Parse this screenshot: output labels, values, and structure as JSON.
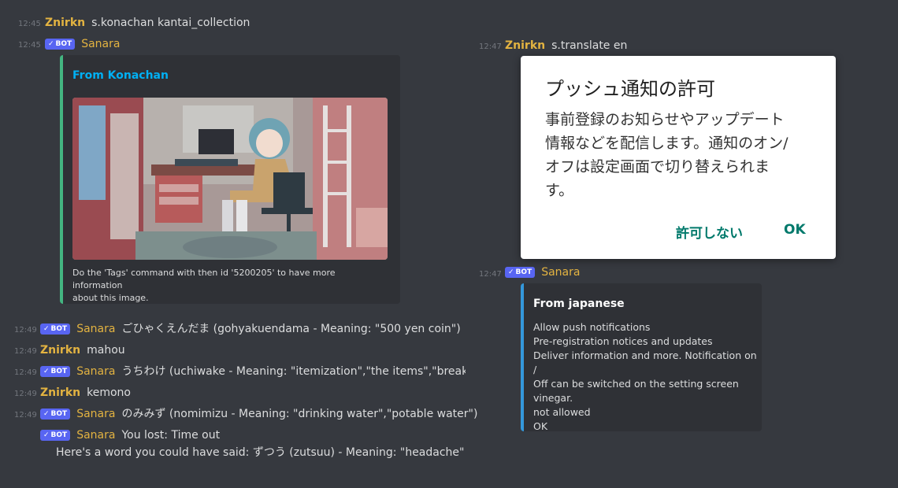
{
  "messages_left": [
    {
      "time": "12:45",
      "author": "Znirkn",
      "text": "s.konachan kantai_collection"
    },
    {
      "time": "12:45",
      "author": "Sanara",
      "bot": "BOT"
    }
  ],
  "konachan_embed": {
    "title": "From Konachan",
    "accent": "#43b581",
    "title_color": "#00b0f4",
    "footer_line1": "Do the 'Tags' command with then id '5200205' to have more information",
    "footer_line2": "about this image."
  },
  "game_messages": [
    {
      "time": "12:49",
      "author": "Sanara",
      "bot": "BOT",
      "text": "ごひゃくえんだま (gohyakuendama - Meaning: \"500 yen coin\")"
    },
    {
      "time": "12:49",
      "author": "Znirkn",
      "text": "mahou"
    },
    {
      "time": "12:49",
      "author": "Sanara",
      "bot": "BOT",
      "text": "うちわけ (uchiwake - Meaning: \"itemization\",\"the items\",\"breakdo"
    },
    {
      "time": "12:49",
      "author": "Znirkn",
      "text": "kemono"
    },
    {
      "time": "12:49",
      "author": "Sanara",
      "bot": "BOT",
      "text": "のみみず (nomimizu - Meaning: \"drinking water\",\"potable water\")"
    },
    {
      "author": "Sanara",
      "bot": "BOT",
      "text": "You lost: Time out"
    },
    {
      "text": "Here's a word you could have said: ずつう (zutsuu) - Meaning: \"headache\""
    }
  ],
  "messages_right": [
    {
      "time": "12:47",
      "author": "Znirkn",
      "text": "s.translate en"
    },
    {
      "time": "12:47",
      "author": "Sanara",
      "bot": "BOT"
    }
  ],
  "dialog": {
    "title": "プッシュ通知の許可",
    "body_lines": [
      "事前登録のお知らせやアップデート",
      "情報などを配信します。通知のオン/",
      "オフは設定画面で切り替えられま",
      "す。"
    ],
    "deny": "許可しない",
    "ok": "OK"
  },
  "translate_embed": {
    "title": "From japanese",
    "accent": "#3498db",
    "lines": [
      "Allow push notifications",
      "Pre-registration notices and updates",
      "Deliver information and more. Notification on /",
      "Off can be switched on the setting screen",
      "vinegar.",
      "not allowed",
      "OK"
    ]
  },
  "colors": {
    "background": "#36393f",
    "embed_bg": "#2f3136",
    "bot_badge": "#5865f2",
    "username": "#e3b341"
  }
}
